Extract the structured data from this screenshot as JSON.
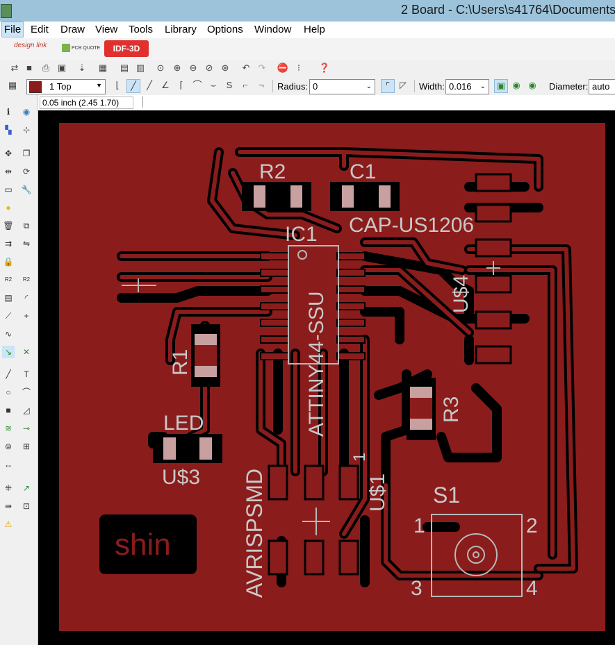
{
  "window": {
    "title": "2 Board - C:\\Users\\s41764\\Documents\\"
  },
  "menu": [
    "File",
    "Edit",
    "Draw",
    "View",
    "Tools",
    "Library",
    "Options",
    "Window",
    "Help"
  ],
  "linkbar": {
    "designlink": "design link",
    "pcbquote": "PCB QUOTE",
    "idf": "IDF-3D"
  },
  "toolbar": {
    "layer": "1 Top",
    "radius_label": "Radius:",
    "radius_value": "0",
    "width_label": "Width:",
    "width_value": "0.016",
    "diameter_label": "Diameter:",
    "diameter_value": "auto"
  },
  "coordinate": "0.05 inch (2.45 1.70)",
  "command": "",
  "board": {
    "colors": {
      "copper": "#8b1c1c",
      "background": "#000000",
      "silk": "#c8c8c8",
      "pad": "#a86060"
    },
    "labels": {
      "r2": "R2",
      "c1": "C1",
      "cap": "CAP-US1206",
      "ic1": "IC1",
      "attiny": "ATTINY44-SSU",
      "us4": "U$4",
      "r1": "R1",
      "r3": "R3",
      "led": "LED",
      "us3": "U$3",
      "avrispsmd": "AVRISPSMD",
      "us1": "U$1",
      "pin1": "1",
      "s1": "S1",
      "s1p1": "1",
      "s1p2": "2",
      "s1p3": "3",
      "s1p4": "4",
      "shin": "shin"
    }
  }
}
